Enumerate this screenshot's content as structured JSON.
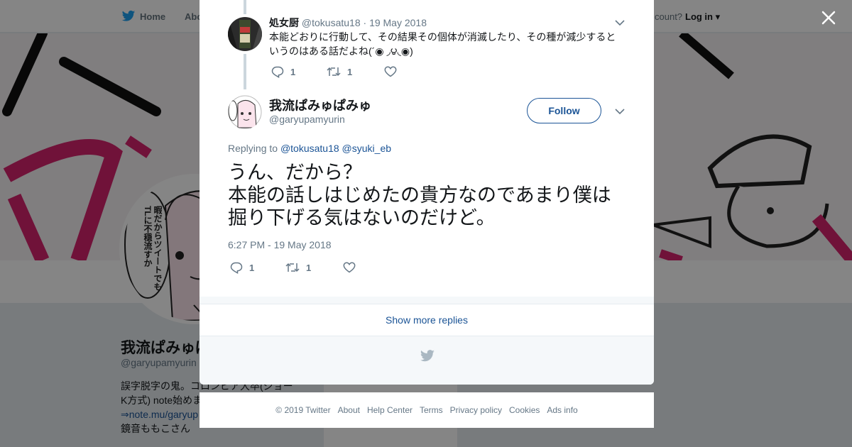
{
  "topbar": {
    "home_label": "Home",
    "about_label": "Abo",
    "account_text": "count?",
    "login_label": "Log in"
  },
  "profile": {
    "name": "我流ぱみゅぱみゅ",
    "handle": "@garyupamyurin",
    "bio_line1": "誤字脱字の鬼。コロンビア大卒(ジョー",
    "bio_line2": "K方式) note始めま",
    "bio_link": "⇒note.mu/garyup",
    "bio_line4": "鏡音ももこさん",
    "avatar_bubble_text": "暇だからツイートでもTLに不穏流すか"
  },
  "modal": {
    "parent_tweet": {
      "name": "処女厨",
      "handle": "@tokusatu18",
      "separator": "·",
      "date": "19 May 2018",
      "text": "本能どおりに行動して、その結果その個体が消滅したり、その種が減少するというのはある話だよね(´◉ ◞౪◟◉)",
      "reply_count": "1",
      "retweet_count": "1"
    },
    "main_tweet": {
      "name": "我流ぱみゅぱみゅ",
      "handle": "@garyupamyurin",
      "follow_label": "Follow",
      "replying_prefix": "Replying to",
      "replying_user1": "@tokusatu18",
      "replying_user2": "@syuki_eb",
      "text_line1": "うん、だから？",
      "text_line2": "本能の話しはじめたの貴方なのであまり僕は",
      "text_line3": "掘り下げる気はないのだけど。",
      "timestamp": "6:27 PM - 19 May 2018",
      "reply_count": "1",
      "retweet_count": "1"
    },
    "show_more_label": "Show more replies"
  },
  "footer": {
    "copyright": "© 2019 Twitter",
    "links": [
      "About",
      "Help Center",
      "Terms",
      "Privacy policy",
      "Cookies",
      "Ads info"
    ]
  },
  "colors": {
    "link_blue": "#1b5496",
    "twitter_blue": "#1da1f2",
    "muted_gray": "#657786",
    "text_dark": "#14171a",
    "banner_pink": "#d6246e"
  }
}
